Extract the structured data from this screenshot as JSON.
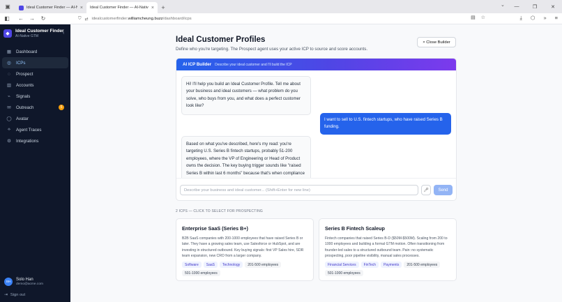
{
  "browser": {
    "tabs": [
      {
        "title": "Ideal Customer Finder — AI-Native",
        "active": false
      },
      {
        "title": "Ideal Customer Finder — AI-Native",
        "active": true
      }
    ],
    "url_prefix": "idealcustomerfinder.",
    "url_host": "williamcheung.buzz",
    "url_path": "/dashboard/icps"
  },
  "sidebar": {
    "brand_title": "Ideal Customer Finder",
    "brand_subtitle": "AI-Native GTM",
    "items": [
      {
        "label": "Dashboard",
        "icon": "grid-icon",
        "active": false
      },
      {
        "label": "ICPs",
        "icon": "target-icon",
        "active": true
      },
      {
        "label": "Prospect",
        "icon": "compass-icon",
        "active": false
      },
      {
        "label": "Accounts",
        "icon": "building-icon",
        "active": false
      },
      {
        "label": "Signals",
        "icon": "signal-icon",
        "active": false
      },
      {
        "label": "Outreach",
        "icon": "mail-icon",
        "active": false,
        "badge": "5"
      },
      {
        "label": "Avatar",
        "icon": "user-icon",
        "active": false
      },
      {
        "label": "Agent Traces",
        "icon": "trace-icon",
        "active": false
      },
      {
        "label": "Integrations",
        "icon": "plug-icon",
        "active": false
      }
    ],
    "user": {
      "initials": "SH",
      "name": "Solo Han",
      "email": "demo@acme.com"
    },
    "sign_out": "Sign out"
  },
  "main": {
    "title": "Ideal Customer Profiles",
    "subtitle": "Define who you're targeting. The Prospect agent uses your active ICP to source and score accounts.",
    "close_button": "× Close Builder",
    "builder": {
      "title": "AI ICP Builder",
      "subtitle": "Describe your ideal customer and I'll build the ICP",
      "messages": [
        {
          "role": "ai",
          "text": "Hi! I'll help you build an Ideal Customer Profile. Tell me about your business and ideal customers — what problem do you solve, who buys from you, and what does a perfect customer look like?"
        },
        {
          "role": "user",
          "text": "I want to sell to U.S. fintech startups, who have raised Series B funding."
        },
        {
          "role": "ai",
          "text": "Based on what you've described, here's my read: you're targeting U.S. Series B fintech startups, probably 51-200 employees, where the VP of Engineering or Head of Product owns the decision. The key buying trigger sounds like \"raised Series B within last 6 months\" because that's when compliance and scaling infrastructure become urgent. Does this match — or what would you change?"
        }
      ],
      "input_placeholder": "Describe your business and ideal customer... (Shift+Enter for new line)",
      "send_label": "Send"
    },
    "section_label": "2 ICPS — CLICK TO SELECT FOR PROSPECTING",
    "icps": [
      {
        "title": "Enterprise SaaS (Series B+)",
        "description": "B2B SaaS companies with 200-1000 employees that have raised Series B or later. They have a growing sales team, use Salesforce or HubSpot, and are investing in structured outbound. Key buying signals: first VP Sales hire, SDR team expansion, new CRO from a larger company.",
        "tags": [
          {
            "label": "Software",
            "kind": "industry"
          },
          {
            "label": "SaaS",
            "kind": "industry"
          },
          {
            "label": "Technology",
            "kind": "industry"
          },
          {
            "label": "201-500 employees",
            "kind": "size"
          },
          {
            "label": "501-1000 employees",
            "kind": "size"
          }
        ]
      },
      {
        "title": "Series B Fintech Scaleup",
        "description": "Fintech companies that raised Series B-D ($50M-$500M). Scaling from 200 to 1000 employees and building a formal GTM motion. Often transitioning from founder-led sales to a structured outbound team. Pain: no systematic prospecting, poor pipeline visibility, manual sales processes.",
        "tags": [
          {
            "label": "Financial Services",
            "kind": "industry"
          },
          {
            "label": "FinTech",
            "kind": "industry"
          },
          {
            "label": "Payments",
            "kind": "industry"
          },
          {
            "label": "201-500 employees",
            "kind": "size"
          },
          {
            "label": "501-1000 employees",
            "kind": "size"
          }
        ]
      }
    ]
  },
  "colors": {
    "sidebar_bg": "#0f172a",
    "accent": "#2563eb",
    "accent_purple": "#7c3aed",
    "badge": "#f59e0b"
  }
}
